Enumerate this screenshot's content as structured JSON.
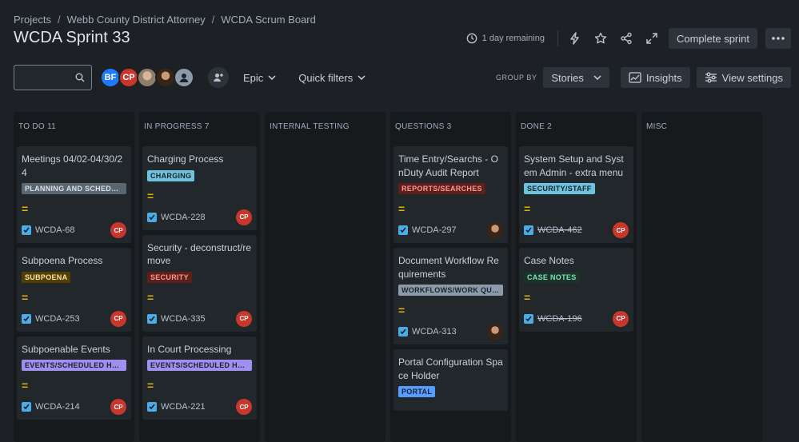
{
  "breadcrumbs": [
    "Projects",
    "Webb County District Attorney",
    "WCDA Scrum Board"
  ],
  "title": "WCDA Sprint 33",
  "header": {
    "remaining": "1 day remaining",
    "complete_label": "Complete sprint",
    "icons": [
      "clock-icon",
      "lightning-icon",
      "star-icon",
      "share-icon",
      "expand-icon",
      "more-icon"
    ]
  },
  "toolbar": {
    "search_placeholder": "",
    "avatars": [
      {
        "initials": "BF",
        "color": "#1d7afc"
      },
      {
        "initials": "CP",
        "color": "#c9372c"
      },
      {
        "initials": "",
        "color": "#8f7f6a"
      },
      {
        "initials": "",
        "color": "#5a3a2a"
      },
      {
        "initials": "",
        "color": "#8c9bab"
      }
    ],
    "epic_label": "Epic",
    "quick_filters_label": "Quick filters",
    "group_by_label": "GROUP BY",
    "group_by_value": "Stories",
    "insights_label": "Insights",
    "view_settings_label": "View settings"
  },
  "columns": [
    {
      "title": "TO DO 11",
      "cards": [
        {
          "title": "Meetings 04/02-04/30/24",
          "label": "PLANNING AND SCHEDU...",
          "label_bg": "#596773",
          "label_fg": "#dcdfe4",
          "key": "WCDA-68",
          "done": false,
          "assignee": "CP"
        },
        {
          "title": "Subpoena Process",
          "label": "SUBPOENA",
          "label_bg": "#533f04",
          "label_fg": "#f8e6a0",
          "key": "WCDA-253",
          "done": false,
          "assignee": "CP"
        },
        {
          "title": "Subpoenable Events",
          "label": "EVENTS/SCHEDULED HE...",
          "label_bg": "#9f8fef",
          "label_fg": "#1d2125",
          "key": "WCDA-214",
          "done": false,
          "assignee": "CP"
        }
      ]
    },
    {
      "title": "IN PROGRESS 7",
      "cards": [
        {
          "title": "Charging Process",
          "label": "CHARGING",
          "label_bg": "#6cc3e0",
          "label_fg": "#1d2125",
          "key": "WCDA-228",
          "done": false,
          "assignee": "CP"
        },
        {
          "title": "Security - deconstruct/remove",
          "label": "SECURITY",
          "label_bg": "#5d1f1a",
          "label_fg": "#fd9891",
          "key": "WCDA-335",
          "done": false,
          "assignee": "CP"
        },
        {
          "title": "In Court Processing",
          "label": "EVENTS/SCHEDULED HE...",
          "label_bg": "#9f8fef",
          "label_fg": "#1d2125",
          "key": "WCDA-221",
          "done": false,
          "assignee": "CP"
        }
      ]
    },
    {
      "title": "INTERNAL TESTING",
      "cards": []
    },
    {
      "title": "QUESTIONS 3",
      "cards": [
        {
          "title": "Time Entry/Searchs - OnDuty Audit Report",
          "label": "REPORTS/SEARCHES",
          "label_bg": "#5d1f1a",
          "label_fg": "#fd9891",
          "key": "WCDA-297",
          "done": false,
          "assignee": "photo"
        },
        {
          "title": "Document Workflow Requirements",
          "label": "WORKFLOWS/WORK QUE...",
          "label_bg": "#8c9bab",
          "label_fg": "#1d2125",
          "key": "WCDA-313",
          "done": false,
          "assignee": "photo"
        },
        {
          "title": "Portal Configuration Space Holder",
          "label": "PORTAL",
          "label_bg": "#579dff",
          "label_fg": "#1d2125",
          "key": "",
          "done": false,
          "assignee": ""
        }
      ]
    },
    {
      "title": "DONE 2",
      "cards": [
        {
          "title": "System Setup and System Admin - extra menu",
          "label": "SECURITY/STAFF",
          "label_bg": "#6cc3e0",
          "label_fg": "#1d2125",
          "key": "WCDA-462",
          "done": true,
          "assignee": "CP"
        },
        {
          "title": "Case Notes",
          "label": "CASE NOTES",
          "label_bg": "#1c3329",
          "label_fg": "#7ee2b8",
          "key": "WCDA-196",
          "done": true,
          "assignee": "CP"
        }
      ]
    },
    {
      "title": "MISC",
      "cards": []
    }
  ],
  "priority_symbol": "="
}
